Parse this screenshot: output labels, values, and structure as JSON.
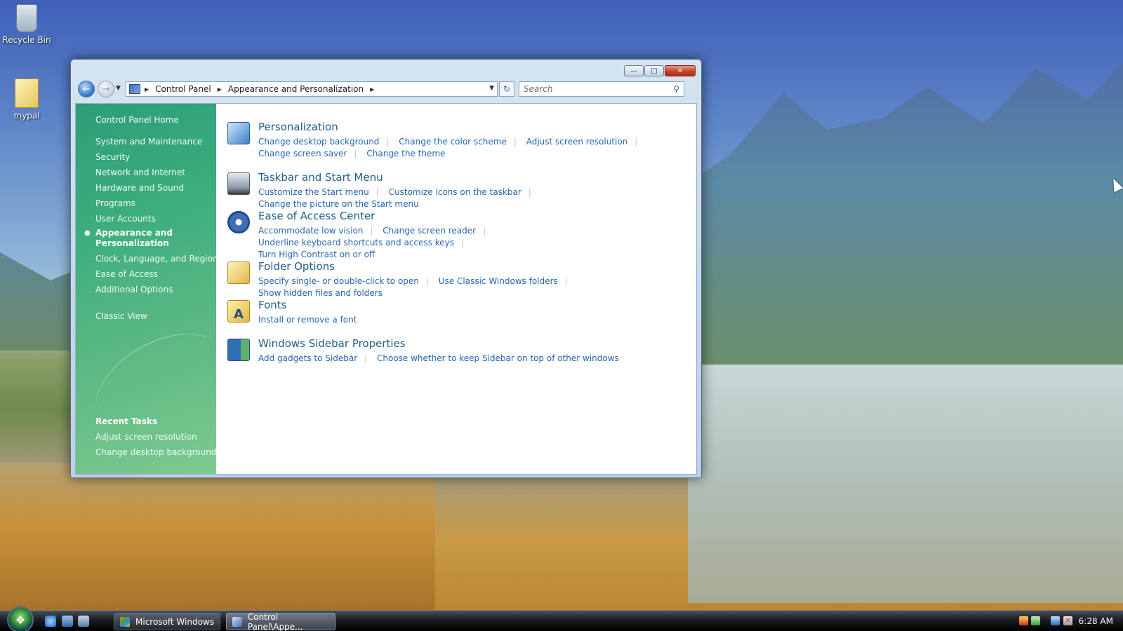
{
  "desktop": {
    "icons": [
      {
        "label": "Recycle Bin"
      },
      {
        "label": "mypal"
      }
    ]
  },
  "window": {
    "address": {
      "crumbs": [
        "Control Panel",
        "Appearance and Personalization"
      ]
    },
    "search": {
      "placeholder": "Search"
    },
    "sidebar": {
      "home": "Control Panel Home",
      "items": [
        "System and Maintenance",
        "Security",
        "Network and Internet",
        "Hardware and Sound",
        "Programs",
        "User Accounts",
        "Appearance and Personalization",
        "Clock, Language, and Region",
        "Ease of Access",
        "Additional Options"
      ],
      "classic_view": "Classic View",
      "recent_tasks_title": "Recent Tasks",
      "recent_tasks": [
        "Adjust screen resolution",
        "Change desktop background"
      ]
    },
    "categories": [
      {
        "title": "Personalization",
        "icon": "personalization-icon",
        "links": [
          "Change desktop background",
          "Change the color scheme",
          "Adjust screen resolution",
          "Change screen saver",
          "Change the theme"
        ]
      },
      {
        "title": "Taskbar and Start Menu",
        "icon": "taskbar-icon",
        "links": [
          "Customize the Start menu",
          "Customize icons on the taskbar",
          "Change the picture on the Start menu"
        ]
      },
      {
        "title": "Ease of Access Center",
        "icon": "ease-of-access-icon",
        "links": [
          "Accommodate low vision",
          "Change screen reader",
          "Underline keyboard shortcuts and access keys",
          "Turn High Contrast on or off"
        ]
      },
      {
        "title": "Folder Options",
        "icon": "folder-options-icon",
        "links": [
          "Specify single- or double-click to open",
          "Use Classic Windows folders",
          "Show hidden files and folders"
        ]
      },
      {
        "title": "Fonts",
        "icon": "fonts-icon",
        "links": [
          "Install or remove a font"
        ]
      },
      {
        "title": "Windows Sidebar Properties",
        "icon": "sidebar-properties-icon",
        "links": [
          "Add gadgets to Sidebar",
          "Choose whether to keep Sidebar on top of other windows"
        ]
      }
    ]
  },
  "taskbar": {
    "buttons": [
      "Microsoft Windows",
      "Control Panel\\Appe..."
    ],
    "clock": "6:28 AM"
  },
  "colors": {
    "link": "#2466b3",
    "category_title": "#1e5c8b",
    "sidebar_green": "#3faf7f"
  }
}
